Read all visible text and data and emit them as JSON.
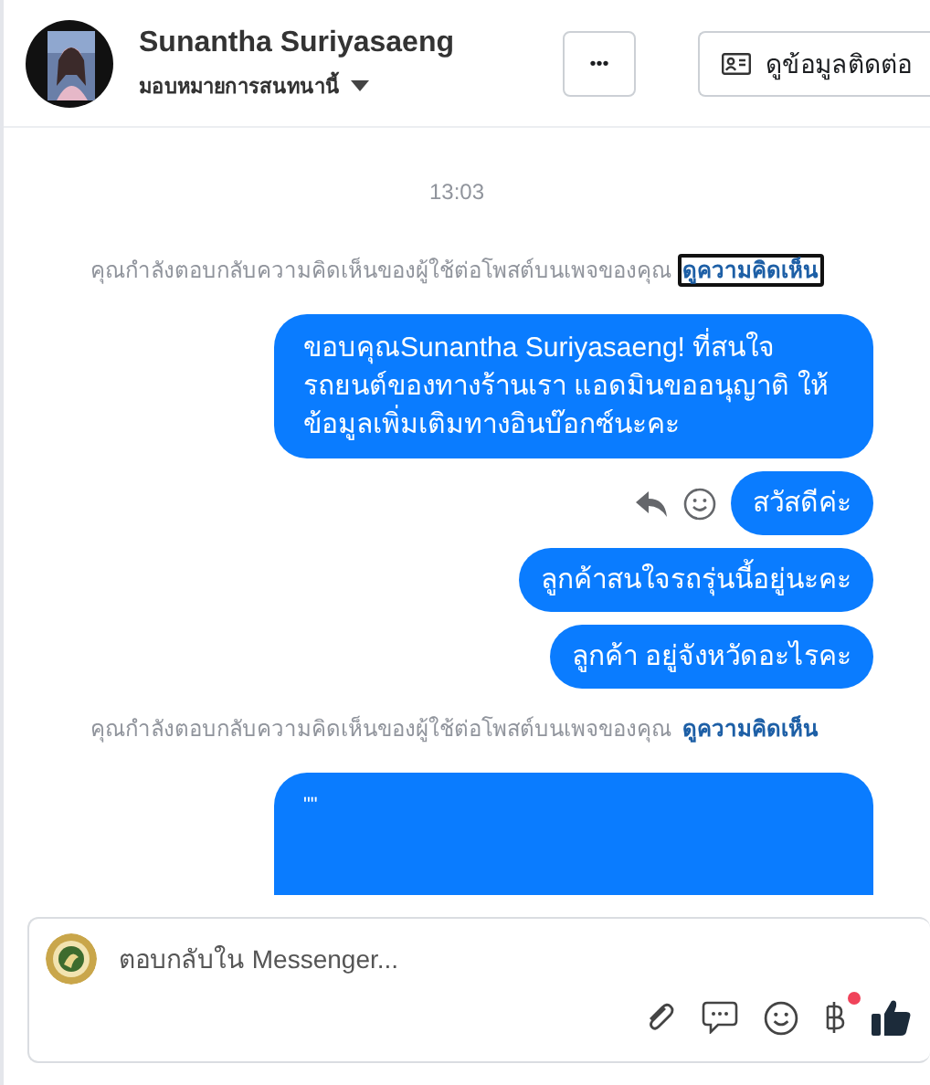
{
  "header": {
    "name": "Sunantha Suriyasaeng",
    "subtitle": "มอบหมายการสนทนานี้",
    "more_button": "•••",
    "contact_button": "ดูข้อมูลติดต่อ"
  },
  "messages": [
    {
      "kind": "timestamp",
      "text": "13:03"
    },
    {
      "kind": "notice",
      "text": "คุณกำลังตอบกลับความคิดเห็นของผู้ใช้ต่อโพสต์บนเพจของคุณ",
      "link": "ดูความคิดเห็น",
      "focused": true
    },
    {
      "kind": "bubble",
      "text": "ขอบคุณSunantha Suriyasaeng! ที่สนใจรถยนต์ของทางร้านเรา แอดมินขออนุญาติ ให้ข้อมูลเพิ่มเติมทางอินบ๊อกซ์นะคะ",
      "hovered": false
    },
    {
      "kind": "bubble",
      "text": "สวัสดีค่ะ",
      "hovered": true
    },
    {
      "kind": "bubble",
      "text": "ลูกค้าสนใจรถรุ่นนี้อยู่นะคะ",
      "hovered": false
    },
    {
      "kind": "bubble",
      "text": "ลูกค้า อยู่จังหวัดอะไรคะ",
      "hovered": false
    },
    {
      "kind": "notice",
      "text": "คุณกำลังตอบกลับความคิดเห็นของผู้ใช้ต่อโพสต์บนเพจของคุณ",
      "link": "ดูความคิดเห็น",
      "focused": false
    },
    {
      "kind": "bubble",
      "text": "\"\"",
      "hovered": false
    }
  ],
  "composer": {
    "placeholder": "ตอบกลับใน Messenger...",
    "payment_notification": true
  }
}
